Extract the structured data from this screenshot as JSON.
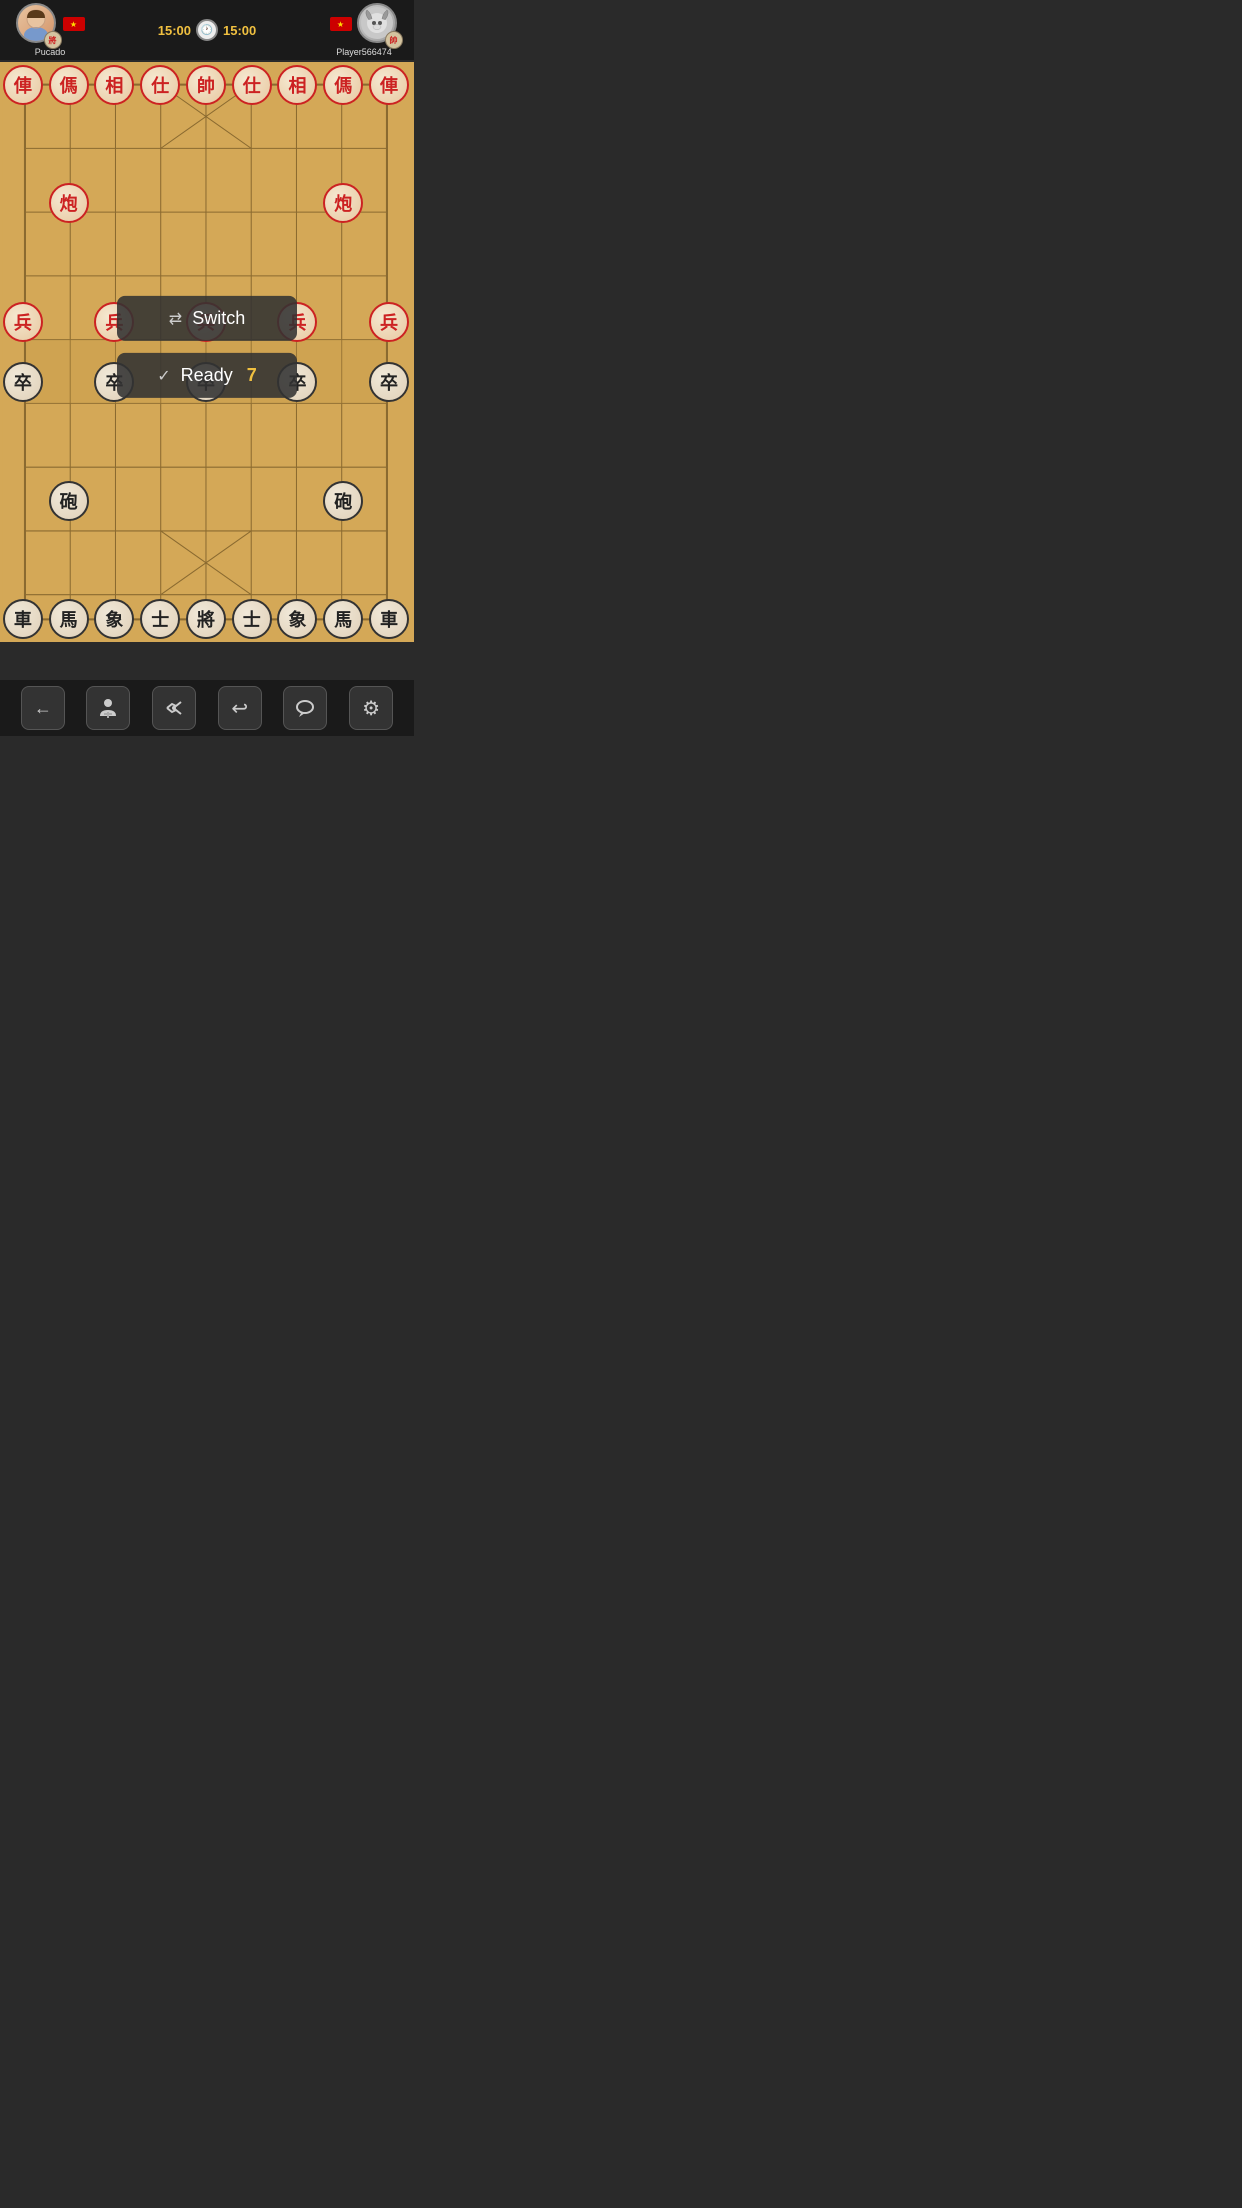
{
  "header": {
    "player_left": {
      "name": "Pucado",
      "avatar_text": "♀",
      "piece_badge": "將",
      "flag": "🇻🇳"
    },
    "player_right": {
      "name": "Player566474",
      "avatar_text": "🐏",
      "piece_badge": "帥",
      "flag": "🇻🇳"
    },
    "timer_left": "15:00",
    "timer_right": "15:00"
  },
  "board": {
    "red_pieces": [
      {
        "char": "俥",
        "col": 0,
        "row": 0,
        "type": "red"
      },
      {
        "char": "傌",
        "col": 1,
        "row": 0,
        "type": "red"
      },
      {
        "char": "相",
        "col": 2,
        "row": 0,
        "type": "red"
      },
      {
        "char": "仕",
        "col": 3,
        "row": 0,
        "type": "red"
      },
      {
        "char": "帥",
        "col": 4,
        "row": 0,
        "type": "red"
      },
      {
        "char": "仕",
        "col": 5,
        "row": 0,
        "type": "red"
      },
      {
        "char": "相",
        "col": 6,
        "row": 0,
        "type": "red"
      },
      {
        "char": "傌",
        "col": 7,
        "row": 0,
        "type": "red"
      },
      {
        "char": "俥",
        "col": 8,
        "row": 0,
        "type": "red"
      },
      {
        "char": "炮",
        "col": 1,
        "row": 2,
        "type": "red"
      },
      {
        "char": "炮",
        "col": 7,
        "row": 2,
        "type": "red"
      },
      {
        "char": "兵",
        "col": 0,
        "row": 4,
        "type": "red"
      },
      {
        "char": "兵",
        "col": 2,
        "row": 4,
        "type": "red"
      },
      {
        "char": "兵",
        "col": 4,
        "row": 4,
        "type": "red"
      },
      {
        "char": "兵",
        "col": 6,
        "row": 4,
        "type": "red"
      },
      {
        "char": "兵",
        "col": 8,
        "row": 4,
        "type": "red"
      }
    ],
    "black_pieces": [
      {
        "char": "車",
        "col": 0,
        "row": 9,
        "type": "black"
      },
      {
        "char": "馬",
        "col": 1,
        "row": 9,
        "type": "black"
      },
      {
        "char": "象",
        "col": 2,
        "row": 9,
        "type": "black"
      },
      {
        "char": "士",
        "col": 3,
        "row": 9,
        "type": "black"
      },
      {
        "char": "將",
        "col": 4,
        "row": 9,
        "type": "black"
      },
      {
        "char": "士",
        "col": 5,
        "row": 9,
        "type": "black"
      },
      {
        "char": "象",
        "col": 6,
        "row": 9,
        "type": "black"
      },
      {
        "char": "馬",
        "col": 7,
        "row": 9,
        "type": "black"
      },
      {
        "char": "車",
        "col": 8,
        "row": 9,
        "type": "black"
      },
      {
        "char": "砲",
        "col": 1,
        "row": 7,
        "type": "black"
      },
      {
        "char": "砲",
        "col": 7,
        "row": 7,
        "type": "black"
      },
      {
        "char": "卒",
        "col": 0,
        "row": 5,
        "type": "black"
      },
      {
        "char": "卒",
        "col": 2,
        "row": 5,
        "type": "black"
      },
      {
        "char": "卒",
        "col": 4,
        "row": 5,
        "type": "black"
      },
      {
        "char": "卒",
        "col": 6,
        "row": 5,
        "type": "black"
      },
      {
        "char": "卒",
        "col": 8,
        "row": 5,
        "type": "black"
      }
    ]
  },
  "overlay": {
    "switch_label": "Switch",
    "ready_label": "Ready",
    "ready_number": "7"
  },
  "toolbar": {
    "back": "←",
    "person": "🚶",
    "handshake": "🤝",
    "undo": "↩",
    "chat": "💬",
    "settings": "⚙"
  }
}
